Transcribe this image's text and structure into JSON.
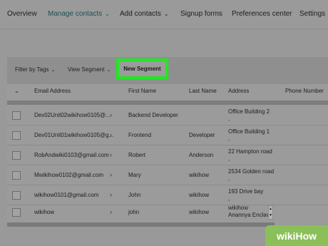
{
  "nav": {
    "items": [
      {
        "label": "Overview"
      },
      {
        "label": "Manage contacts"
      },
      {
        "label": "Add contacts"
      },
      {
        "label": "Signup forms"
      },
      {
        "label": "Preferences center"
      },
      {
        "label": "Settings"
      }
    ]
  },
  "toolbar": {
    "filter_by_tags": "Filter by Tags",
    "view_segment": "View Segment",
    "new_segment": "New Segment"
  },
  "table": {
    "columns": [
      "Email Address",
      "First Name",
      "Last Name",
      "Address",
      "Phone Number"
    ],
    "rows": [
      {
        "email": "Dev02Unit02wikihow0105@...",
        "first": "Backend Developer",
        "last": "",
        "address": "Office Building 2",
        "address2": ","
      },
      {
        "email": "Dev01Unit01wikihow0105@g...",
        "first": "Frontend",
        "last": "Developer",
        "address": "Office Building 1",
        "address2": ","
      },
      {
        "email": "RobAndwiki0103@gmail.com",
        "first": "Robert",
        "last": "Anderson",
        "address": "22 Hampton road",
        "address2": ","
      },
      {
        "email": "Mwikihow0102@gmail.com",
        "first": "Mary",
        "last": "wikihow",
        "address": "2534 Golden road",
        "address2": ","
      },
      {
        "email": "wikihow0101@gmail.com",
        "first": "John",
        "last": "wikihow",
        "address": "193 Drive bay",
        "address2": ","
      },
      {
        "email": "wikihow",
        "first": "john",
        "last": "wikihow",
        "address": "wikihow",
        "address2": "Anannya Enclave"
      }
    ]
  },
  "watermark": {
    "wiki": "wiki",
    "how": "How"
  }
}
